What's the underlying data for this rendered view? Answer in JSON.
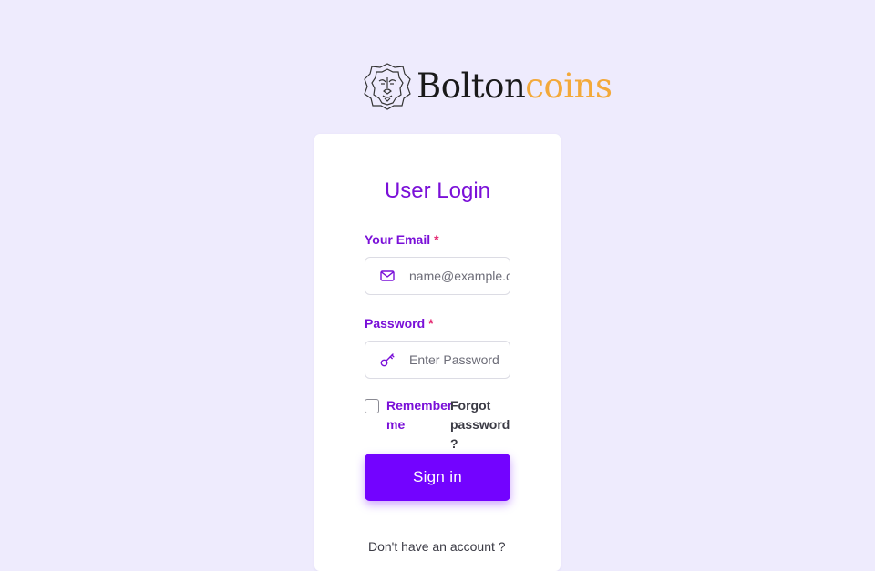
{
  "brand": {
    "name_part1": "Bolton",
    "name_part2": "coins",
    "logo_icon": "lion-head-icon",
    "accent_color": "#f3a93a"
  },
  "login": {
    "title": "User Login",
    "email_label": "Your Email",
    "email_placeholder": "name@example.com",
    "password_label": "Password",
    "password_placeholder": "Enter Password",
    "required_marker": "*",
    "remember_label": "Remember me",
    "forgot_label": "Forgot password ?",
    "signin_label": "Sign in",
    "signup_prompt": "Don't have an account ?"
  },
  "colors": {
    "primary": "#7303ff",
    "label": "#7a10d8",
    "required": "#e4256f",
    "background": "#eeebfd"
  }
}
